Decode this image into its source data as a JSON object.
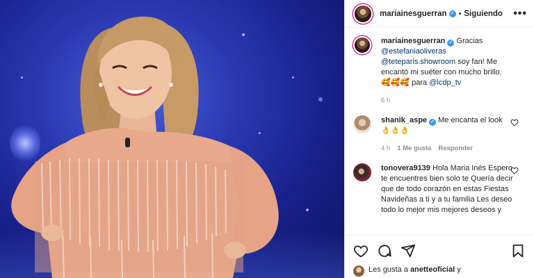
{
  "post": {
    "username": "mariainesguerran",
    "follow_status": "Siguiendo",
    "separator": "•",
    "more_label": "•••"
  },
  "caption": {
    "username": "mariainesguerran",
    "text_1": "Gracias",
    "mention_1": "@estefaniaoliveras",
    "mention_2": "@teteparis.showroom",
    "text_2": "soy fan! Me encantó mi suéter con mucho brillo.",
    "emojis": "🥰🥰🥰",
    "text_3": "para",
    "mention_3": "@lcdp_tv",
    "time": "6 h"
  },
  "comments": [
    {
      "username": "shanik_aspe",
      "text": "Me encanta el look 👌👌👌",
      "time": "4 h",
      "likes": "1 Me gusta",
      "reply": "Responder"
    },
    {
      "username": "tonovera9139",
      "text": "Hola Maria Inés Espero te encuentres bien solo te Quería decir que de todo corazón en estas Fiestas Navideñas a ti y a tu familia Les deseo todo lo mejor mis mejores deseos y"
    }
  ],
  "likes_bar": {
    "prefix": "Les gusta a",
    "user": "anetteoficial",
    "suffix": "y"
  },
  "colors": {
    "accent": "#3897f0",
    "mention": "#00376b",
    "muted": "#8e8e8e",
    "backdrop": "#2a38b0"
  }
}
